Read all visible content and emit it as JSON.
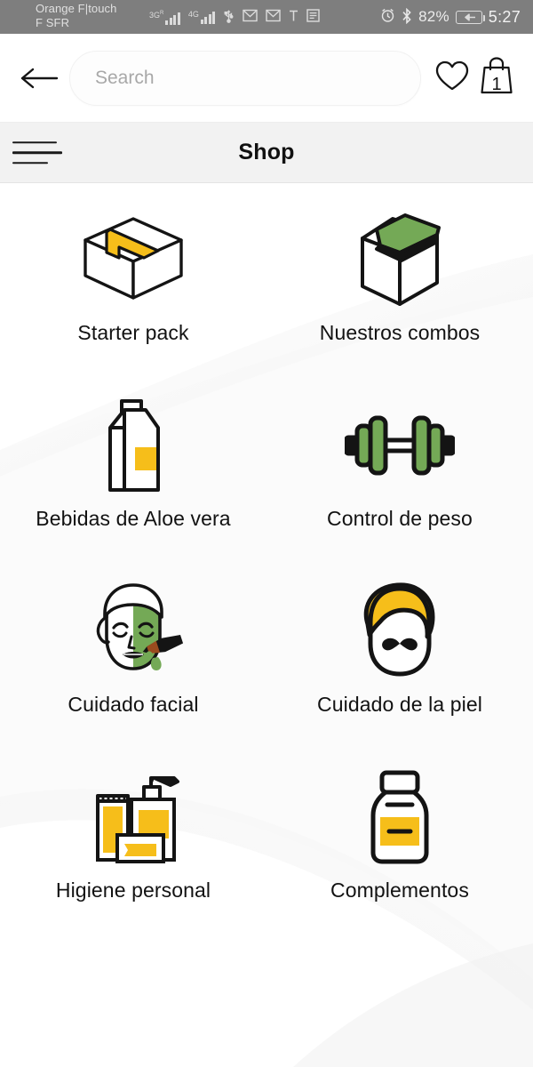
{
  "statusbar": {
    "carrier_line1": "Orange F|touch",
    "carrier_line2": "F SFR",
    "net1_label": "3G",
    "net1_sup": "R",
    "net2_label": "4G",
    "usb_icon": "usb-icon",
    "mail_icon_1": "mail-icon",
    "mail_icon_2": "mail-icon",
    "text_icon": "text-format-icon",
    "list_icon": "list-icon",
    "alarm_icon": "alarm-icon",
    "bluetooth_icon": "bluetooth-icon",
    "battery_percent": "82%",
    "battery_icon": "battery-charging-icon",
    "time": "5:27",
    "bg_color": "#7e7e7e"
  },
  "search": {
    "back_icon": "back-arrow-icon",
    "placeholder": "Search",
    "value": "",
    "favorites_icon": "heart-icon",
    "bag_icon": "shopping-bag-icon",
    "bag_count": "1"
  },
  "header": {
    "menu_icon": "hamburger-menu-icon",
    "title": "Shop"
  },
  "colors": {
    "yellow": "#F6BE1A",
    "green": "#74A956",
    "outline": "#141414",
    "page_bg": "#fbfbfb"
  },
  "categories": [
    {
      "label": "Starter pack",
      "icon": "closed-box-icon"
    },
    {
      "label": "Nuestros combos",
      "icon": "open-box-icon"
    },
    {
      "label": "Bebidas de Aloe vera",
      "icon": "beverage-carton-icon"
    },
    {
      "label": "Control de peso",
      "icon": "dumbbell-icon"
    },
    {
      "label": "Cuidado facial",
      "icon": "face-mask-icon"
    },
    {
      "label": "Cuidado de la piel",
      "icon": "bearded-man-face-icon"
    },
    {
      "label": "Higiene personal",
      "icon": "toiletries-icon"
    },
    {
      "label": "Complementos",
      "icon": "supplement-bottle-icon"
    }
  ]
}
